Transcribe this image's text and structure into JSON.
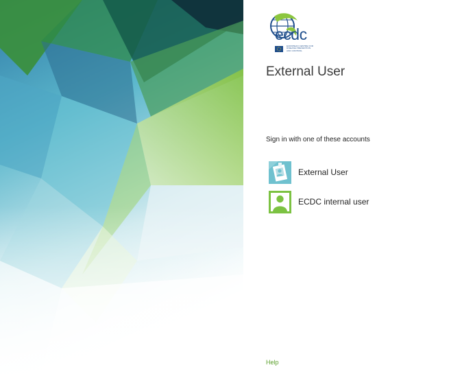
{
  "logo": {
    "wordmark": "ecdc",
    "subtext": "European Centre for Disease Prevention and Control"
  },
  "page_title": "External User",
  "sign_in_prompt": "Sign in with one of these accounts",
  "accounts": [
    {
      "label": "External User",
      "icon": "badge-user-icon",
      "color": "#6fc1cf"
    },
    {
      "label": "ECDC internal user",
      "icon": "person-icon",
      "color": "#7cc242"
    }
  ],
  "footer": {
    "help_label": "Help"
  },
  "colors": {
    "brand_blue": "#1f4e8c",
    "brand_green": "#7cc242",
    "link_green": "#5a9f2a"
  }
}
